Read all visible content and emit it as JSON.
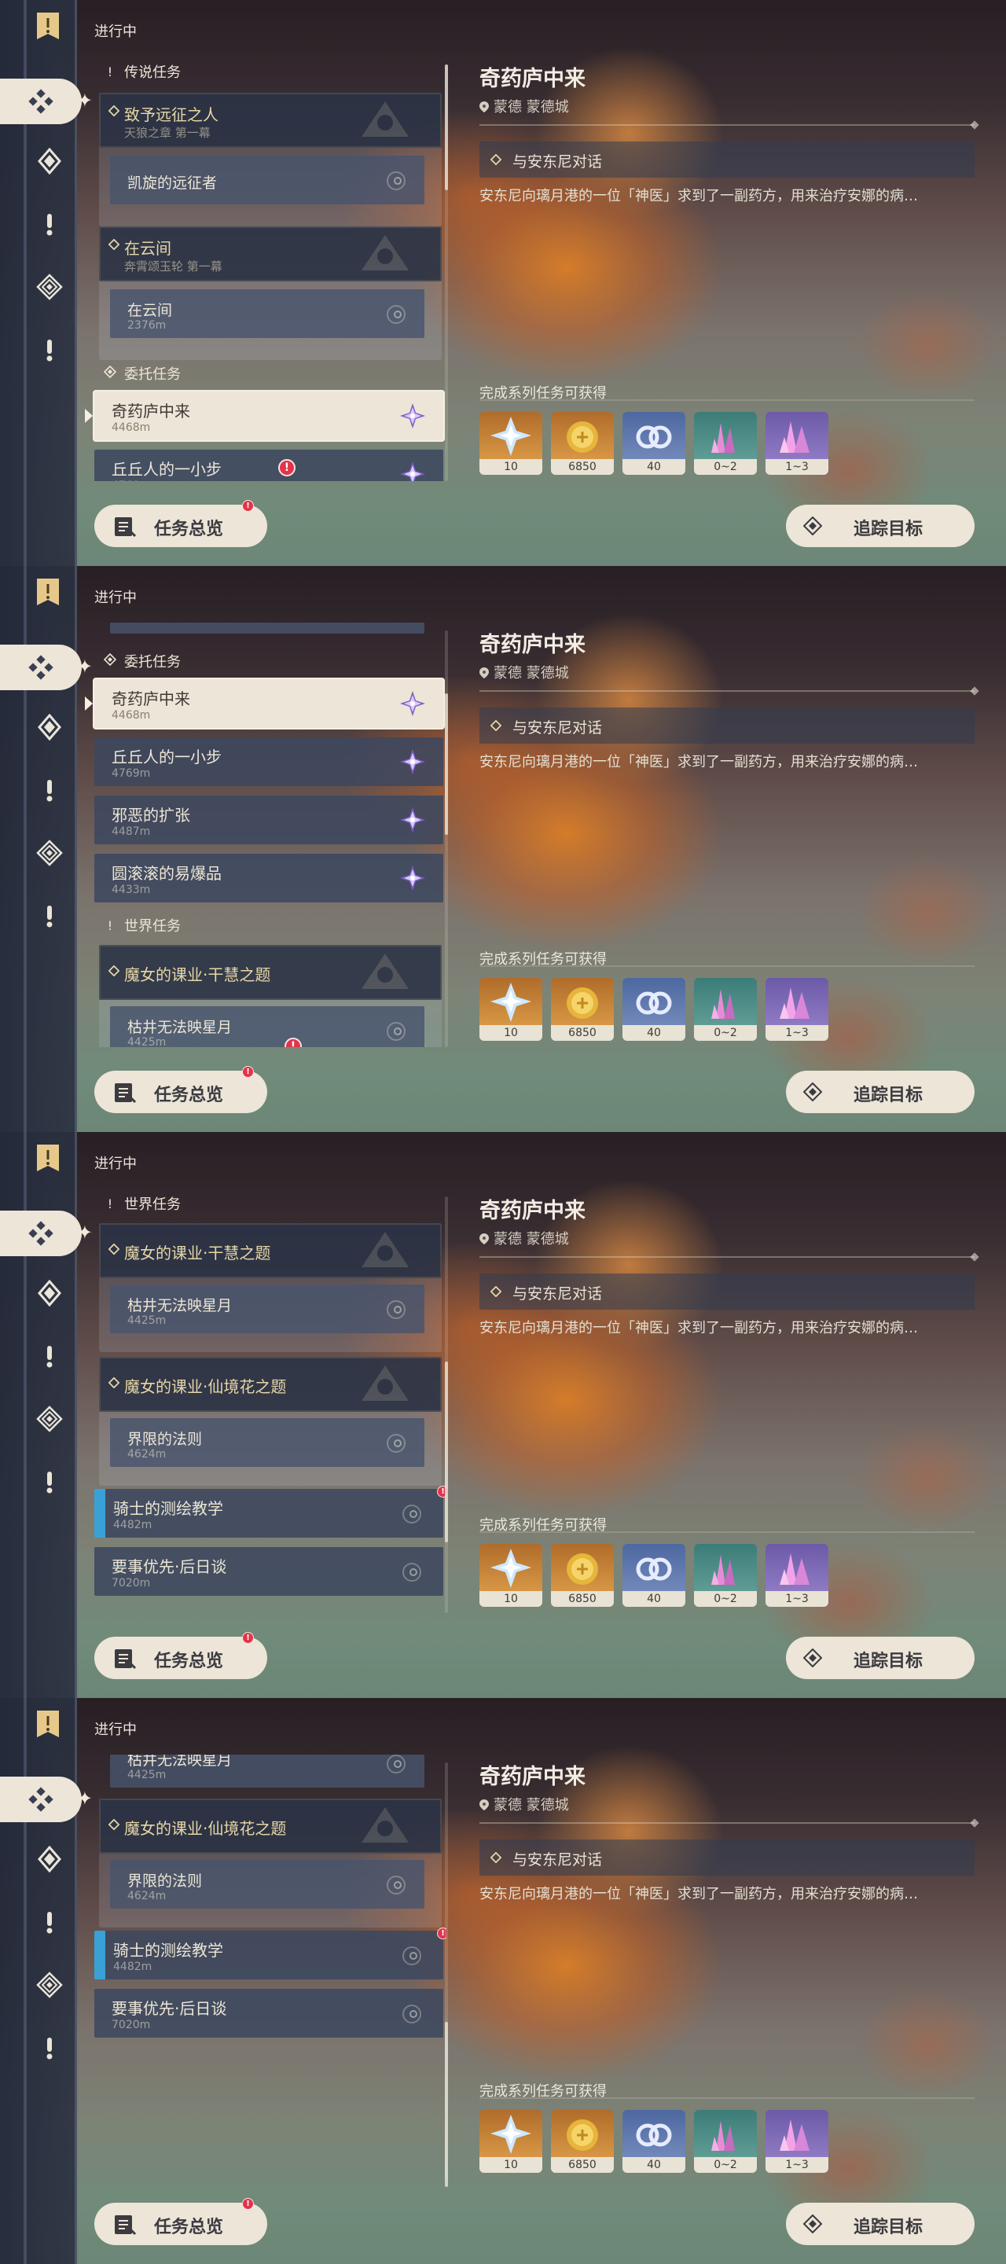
{
  "header": {
    "title": "进行中"
  },
  "categories": {
    "legend": "传说任务",
    "commission": "委托任务",
    "world": "世界任务"
  },
  "legend_quests": [
    {
      "title": "致予远征之人",
      "subtitle": "天狼之章 第一幕",
      "sub": {
        "title": "凯旋的远征者"
      }
    },
    {
      "title": "在云间",
      "subtitle": "奔霄颂玉轮 第一幕",
      "sub": {
        "title": "在云间",
        "distance": "2376m"
      }
    }
  ],
  "commissions": [
    {
      "title": "奇药庐中来",
      "distance": "4468m"
    },
    {
      "title": "丘丘人的一小步",
      "distance": "4769m"
    },
    {
      "title": "邪恶的扩张",
      "distance": "4487m"
    },
    {
      "title": "圆滚滚的易爆品",
      "distance": "4433m"
    }
  ],
  "world_quests": [
    {
      "title": "魔女的课业·干慧之题",
      "sub": {
        "title": "枯井无法映星月",
        "distance": "4425m"
      }
    },
    {
      "title": "魔女的课业·仙境花之题",
      "sub": {
        "title": "界限的法则",
        "distance": "4624m"
      }
    },
    {
      "title": "骑士的测绘教学",
      "distance": "4482m"
    },
    {
      "title": "要事优先·后日谈",
      "distance": "7020m"
    }
  ],
  "detail": {
    "title": "奇药庐中来",
    "location": "蒙德 蒙德城",
    "objective": "与安东尼对话",
    "description": "安东尼向璃月港的一位「神医」求到了一副药方，用来治疗安娜的病…",
    "rewards_label": "完成系列任务可获得",
    "rewards": [
      {
        "icon": "primogem-icon",
        "count": "10"
      },
      {
        "icon": "mora-icon",
        "count": "6850"
      },
      {
        "icon": "adventure-exp-icon",
        "count": "40"
      },
      {
        "icon": "crystal-shard-icon",
        "count": "0~2"
      },
      {
        "icon": "crystal-cluster-icon",
        "count": "1~3"
      }
    ]
  },
  "buttons": {
    "overview": "任务总览",
    "track": "追踪目标"
  },
  "alert_mark": "!"
}
